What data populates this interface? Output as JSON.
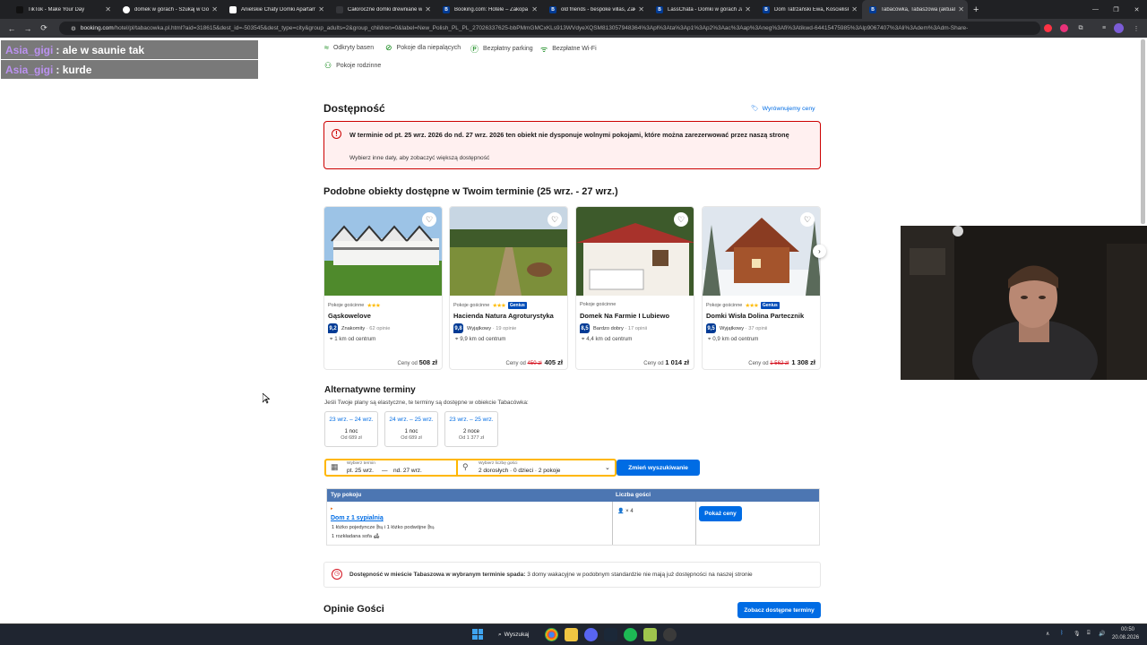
{
  "browser": {
    "tabs": [
      {
        "title": "TikTok - Make Your Day",
        "icon": "tiktok-icon",
        "color": "#111111"
      },
      {
        "title": "domek w górach - Szukaj w Go",
        "icon": "google-icon",
        "color": "#ffffff"
      },
      {
        "title": "Anielskie Chaty Domki Apartam",
        "icon": "page-icon",
        "color": "#ffffff"
      },
      {
        "title": "Całoroczne domki drewniane w",
        "icon": "page-icon",
        "color": "#35363a"
      },
      {
        "title": "Booking.com: Hotele – Zakopa",
        "icon": "booking-icon",
        "color": "#003b95"
      },
      {
        "title": "old friends - bespoke villas, Zak",
        "icon": "booking-icon",
        "color": "#003b95"
      },
      {
        "title": "LassChata - Domki w górach Ja",
        "icon": "booking-icon",
        "color": "#003b95"
      },
      {
        "title": "Dom Tatrzański Ewa, Kościelisk",
        "icon": "booking-icon",
        "color": "#003b95"
      },
      {
        "title": "Tabacówka, Tabaszowa (aktuali",
        "icon": "booking-icon",
        "color": "#003b95"
      }
    ],
    "url_host": "booking.com",
    "url_rest": "/hotel/pl/tabacowka.pl.html?aid=318615&dest_id=-503545&dest_type=city&group_adults=2&group_children=0&label=New_Polish_PL_PL_27026337625-bbPMmGMCxKLs913WVdyeXQSM813057948364%3Apl%3Ata%3Ap1%3Ap2%3Aac%3Aap%3Aneg%3Afi%3Atikwd-64415475985%3Alp9067407%3Ali%3Adem%3Adm-Share-"
  },
  "chat": [
    {
      "user": "Asia_gigi",
      "msg": ": ale w saunie tak"
    },
    {
      "user": "Asia_gigi",
      "msg": ": kurde"
    }
  ],
  "amenities": {
    "pool": "Odkryty basen",
    "nonsmoking": "Pokoje dla niepalących",
    "parking": "Bezpłatny parking",
    "wifi": "Bezpłatne Wi-Fi",
    "family": "Pokoje rodzinne"
  },
  "availability": {
    "heading": "Dostępność",
    "price_match": "Wyrównujemy ceny",
    "alert_title": "W terminie od pt. 25 wrz. 2026 do nd. 27 wrz. 2026 ten obiekt nie dysponuje wolnymi pokojami, które można zarezerwować przez naszą stronę",
    "alert_sub": "Wybierz inne daty, aby zobaczyć większą dostępność"
  },
  "similar": {
    "heading": "Podobne obiekty dostępne w Twoim terminie (25 wrz. - 27 wrz.)",
    "price_prefix": "Ceny od",
    "cards": [
      {
        "type": "Pokoje gościnne",
        "stars": "★★★",
        "genius": "",
        "name": "Gąskowelove",
        "score": "9,2",
        "rating": "Znakomity",
        "reviews": "· 62 opinie",
        "distance": "1 km od centrum",
        "old_price": "",
        "price": "508 zł"
      },
      {
        "type": "Pokoje gościnne",
        "stars": "★★★",
        "genius": "Genius",
        "name": "Hacienda Natura Agroturystyka",
        "score": "9,8",
        "rating": "Wyjątkowy",
        "reviews": "· 19 opinie",
        "distance": "9,9 km od centrum",
        "old_price": "450 zł",
        "price": "405 zł"
      },
      {
        "type": "Pokoje gościnne",
        "stars": "",
        "genius": "",
        "name": "Domek Na Farmie I Lubiewo",
        "score": "8,5",
        "rating": "Bardzo dobry",
        "reviews": "· 17 opinii",
        "distance": "4,4 km od centrum",
        "old_price": "",
        "price": "1 014 zł"
      },
      {
        "type": "Pokoje gościnne",
        "stars": "★★★",
        "genius": "Genius",
        "name": "Domki Wisła Dolina Partecznik",
        "score": "9,5",
        "rating": "Wyjątkowy",
        "reviews": "· 37 opinii",
        "distance": "0,9 km od centrum",
        "old_price": "1 562 zł",
        "price": "1 308 zł"
      }
    ]
  },
  "alternative": {
    "heading": "Alternatywne terminy",
    "sub": "Jeśli Twoje plany są elastyczne, te terminy są dostępne w obiekcie Tabacówka:",
    "options": [
      {
        "dates": "23 wrz. – 24 wrz.",
        "nights": "1 noc",
        "price": "Od 689 zł"
      },
      {
        "dates": "24 wrz. – 25 wrz.",
        "nights": "1 noc",
        "price": "Od 689 zł"
      },
      {
        "dates": "23 wrz. – 25 wrz.",
        "nights": "2 noce",
        "price": "Od 1 377 zł"
      }
    ]
  },
  "search": {
    "date_label": "Wybierz termin",
    "date_from": "pt. 25 wrz.",
    "date_dash": "—",
    "date_to": "nd. 27 wrz.",
    "guests_label": "Wybierz liczbę gości",
    "guests_value": "2 dorosłych · 0 dzieci · 2 pokoje",
    "button": "Zmień wyszukiwanie"
  },
  "room_table": {
    "col_type": "Typ pokoju",
    "col_guests": "Liczba gości",
    "room_name": "Dom z 1 sypialnią",
    "bed1": "1 łóżko pojedyncze",
    "bed_and": "i 1 łóżko podwójne",
    "bed2": "1 rozkładana sofa",
    "guests": "× 4",
    "button": "Pokaż ceny"
  },
  "note": {
    "bold": "Dostępność w mieście Tabaszowa w wybranym terminie spada:",
    "text": " 3 domy wakacyjne w podobnym standardzie nie mają już dostępności na naszej stronie"
  },
  "reviews": {
    "heading": "Opinie Gości",
    "button": "Zobacz dostępne terminy"
  },
  "taskbar": {
    "search": "Wyszukaj",
    "time": "00:50",
    "date": "20.08.2026"
  },
  "colors": {
    "booking_blue": "#006ce4",
    "booking_dark": "#003b95",
    "alert_red": "#cc0000",
    "star_yellow": "#febb02",
    "table_header": "#4c76b2"
  }
}
